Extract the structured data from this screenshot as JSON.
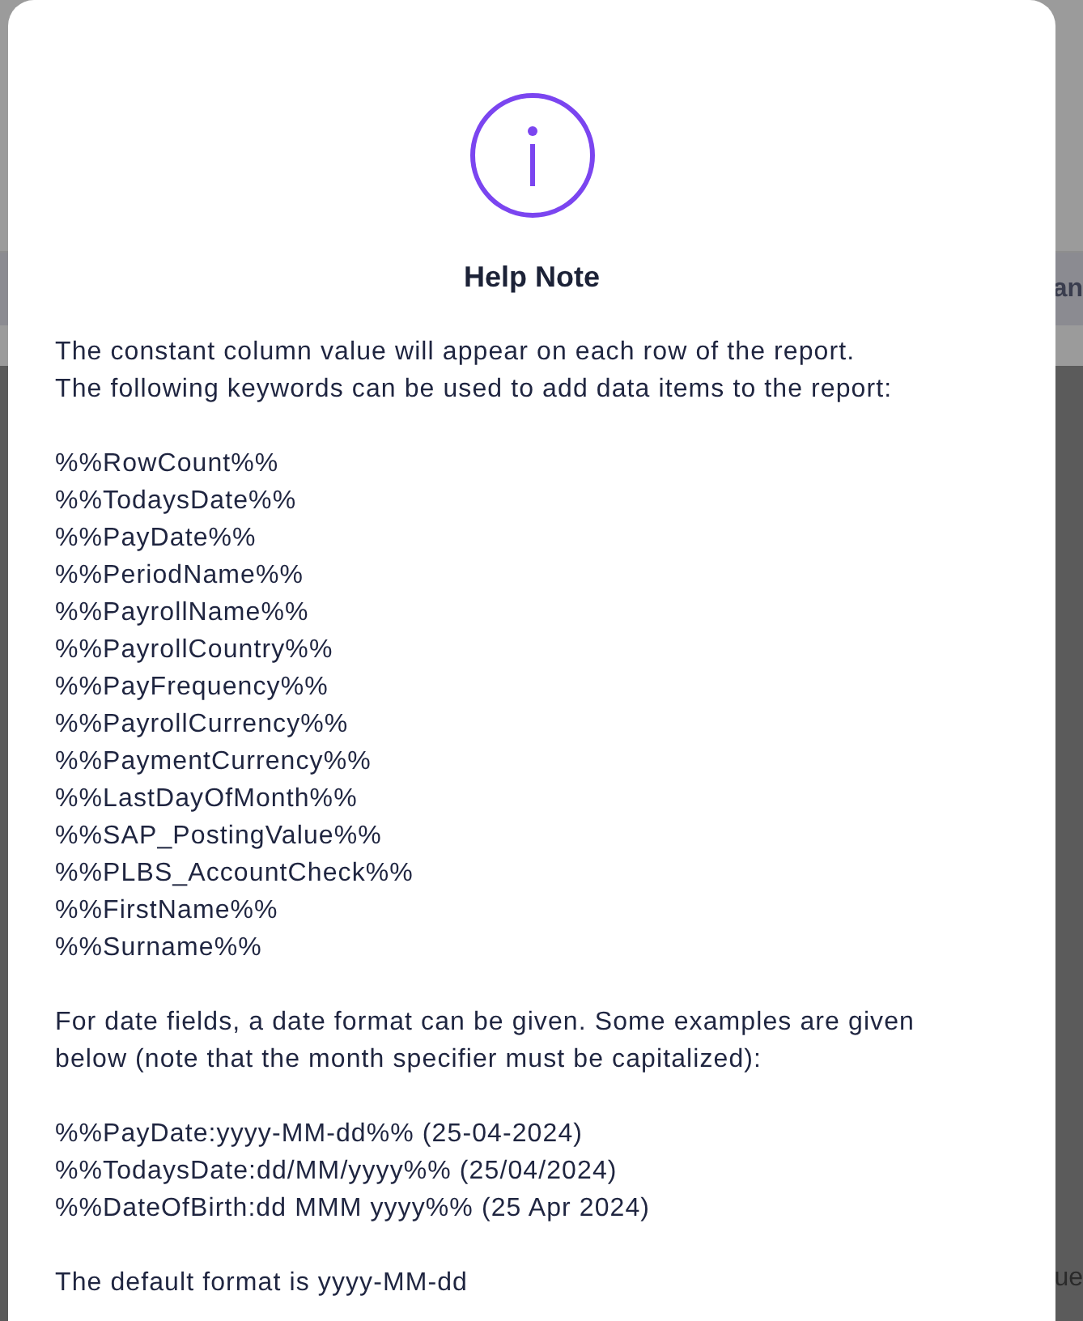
{
  "background": {
    "band_text": "an",
    "lower_text": "ue"
  },
  "dialog": {
    "title": "Help Note",
    "intro": [
      "The constant column value will appear on each row of the report.",
      "The following keywords can be used to add data items to the report:"
    ],
    "keywords": [
      "%%RowCount%%",
      "%%TodaysDate%%",
      "%%PayDate%%",
      "%%PeriodName%%",
      "%%PayrollName%%",
      "%%PayrollCountry%%",
      "%%PayFrequency%%",
      "%%PayrollCurrency%%",
      "%%PaymentCurrency%%",
      "%%LastDayOfMonth%%",
      "%%SAP_PostingValue%%",
      "%%PLBS_AccountCheck%%",
      "%%FirstName%%",
      "%%Surname%%"
    ],
    "date_note": "For date fields, a date format can be given. Some examples are given below (note that the month specifier must be capitalized):",
    "examples": [
      "%%PayDate:yyyy-MM-dd%% (25-04-2024)",
      "%%TodaysDate:dd/MM/yyyy%% (25/04/2024)",
      "%%DateOfBirth:dd MMM yyyy%% (25 Apr 2024)"
    ],
    "default_note": "The default format is yyyy-MM-dd"
  }
}
